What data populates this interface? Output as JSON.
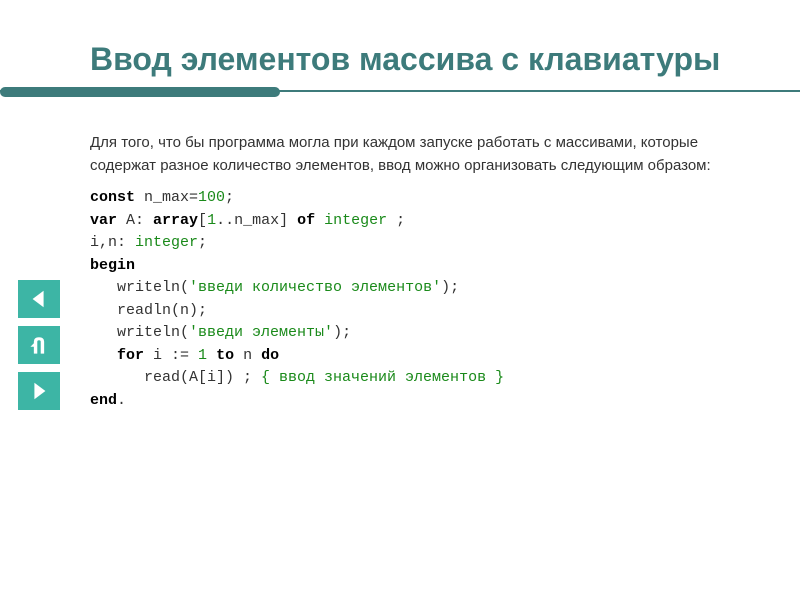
{
  "title": "Ввод элементов массива с клавиатуры",
  "intro": "Для того, что бы программа могла при каждом запуске работать с массивами, которые содержат разное количество элементов, ввод можно организовать следующим образом:",
  "code": {
    "l1_kw1": "const",
    "l1_rest": " n_max=",
    "l1_num": "100",
    "l1_semi": ";",
    "l2_kw1": "var",
    "l2_a": " A: ",
    "l2_kw2": "array",
    "l2_b": "[",
    "l2_num1": "1",
    "l2_c": "..n_max] ",
    "l2_kw3": "of",
    "l2_d": " ",
    "l2_type": "integer",
    "l2_e": " ;",
    "l3_a": "i,n: ",
    "l3_type": "integer",
    "l3_b": ";",
    "l4_kw": "begin",
    "l5_a": "   writeln(",
    "l5_str": "'введи количество элементов'",
    "l5_b": ");",
    "l6": "   readln(n);",
    "l7_a": "   writeln(",
    "l7_str": "'введи элементы'",
    "l7_b": ");",
    "l8_a": "   ",
    "l8_kw1": "for",
    "l8_b": " i := ",
    "l8_num": "1",
    "l8_c": " ",
    "l8_kw2": "to",
    "l8_d": " n ",
    "l8_kw3": "do",
    "l9_a": "      read(A[i]) ; ",
    "l9_comment": "{ ввод значений элементов }",
    "l10_kw": "end",
    "l10_b": "."
  },
  "nav": {
    "prev": "prev-arrow-icon",
    "home": "u-turn-icon",
    "next": "next-arrow-icon"
  }
}
